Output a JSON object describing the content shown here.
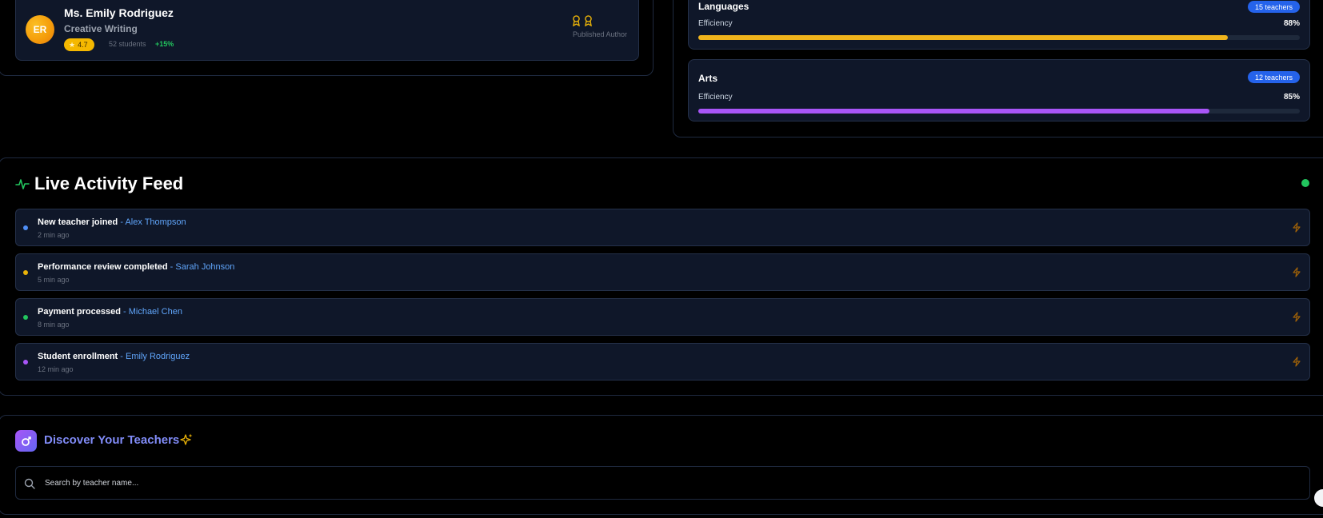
{
  "teacher": {
    "initials": "ER",
    "name": "Ms. Emily Rodriguez",
    "subject": "Creative Writing",
    "rating": "4.7",
    "students": "52 students",
    "growth": "+15%",
    "award_label": "Published Author"
  },
  "subjects": [
    {
      "name": "Languages",
      "badge": "15 teachers",
      "efficiency_label": "Efficiency",
      "percent": "88%",
      "value": 88,
      "color": "#f0b41c"
    },
    {
      "name": "Arts",
      "badge": "12 teachers",
      "efficiency_label": "Efficiency",
      "percent": "85%",
      "value": 85,
      "color": "#a855f7"
    }
  ],
  "feed": {
    "title": "Live Activity Feed",
    "items": [
      {
        "action": "New teacher joined",
        "sep": " - ",
        "person": "Alex Thompson",
        "time": "2 min ago",
        "dot": "#4f8ff7"
      },
      {
        "action": "Performance review completed",
        "sep": " - ",
        "person": "Sarah Johnson",
        "time": "5 min ago",
        "dot": "#eab308"
      },
      {
        "action": "Payment processed",
        "sep": " - ",
        "person": "Michael Chen",
        "time": "8 min ago",
        "dot": "#22c55e"
      },
      {
        "action": "Student enrollment",
        "sep": " - ",
        "person": "Emily Rodriguez",
        "time": "12 min ago",
        "dot": "#a855f7"
      }
    ]
  },
  "discover": {
    "title": "Discover Your Teachers",
    "search_placeholder": "Search by teacher name..."
  }
}
